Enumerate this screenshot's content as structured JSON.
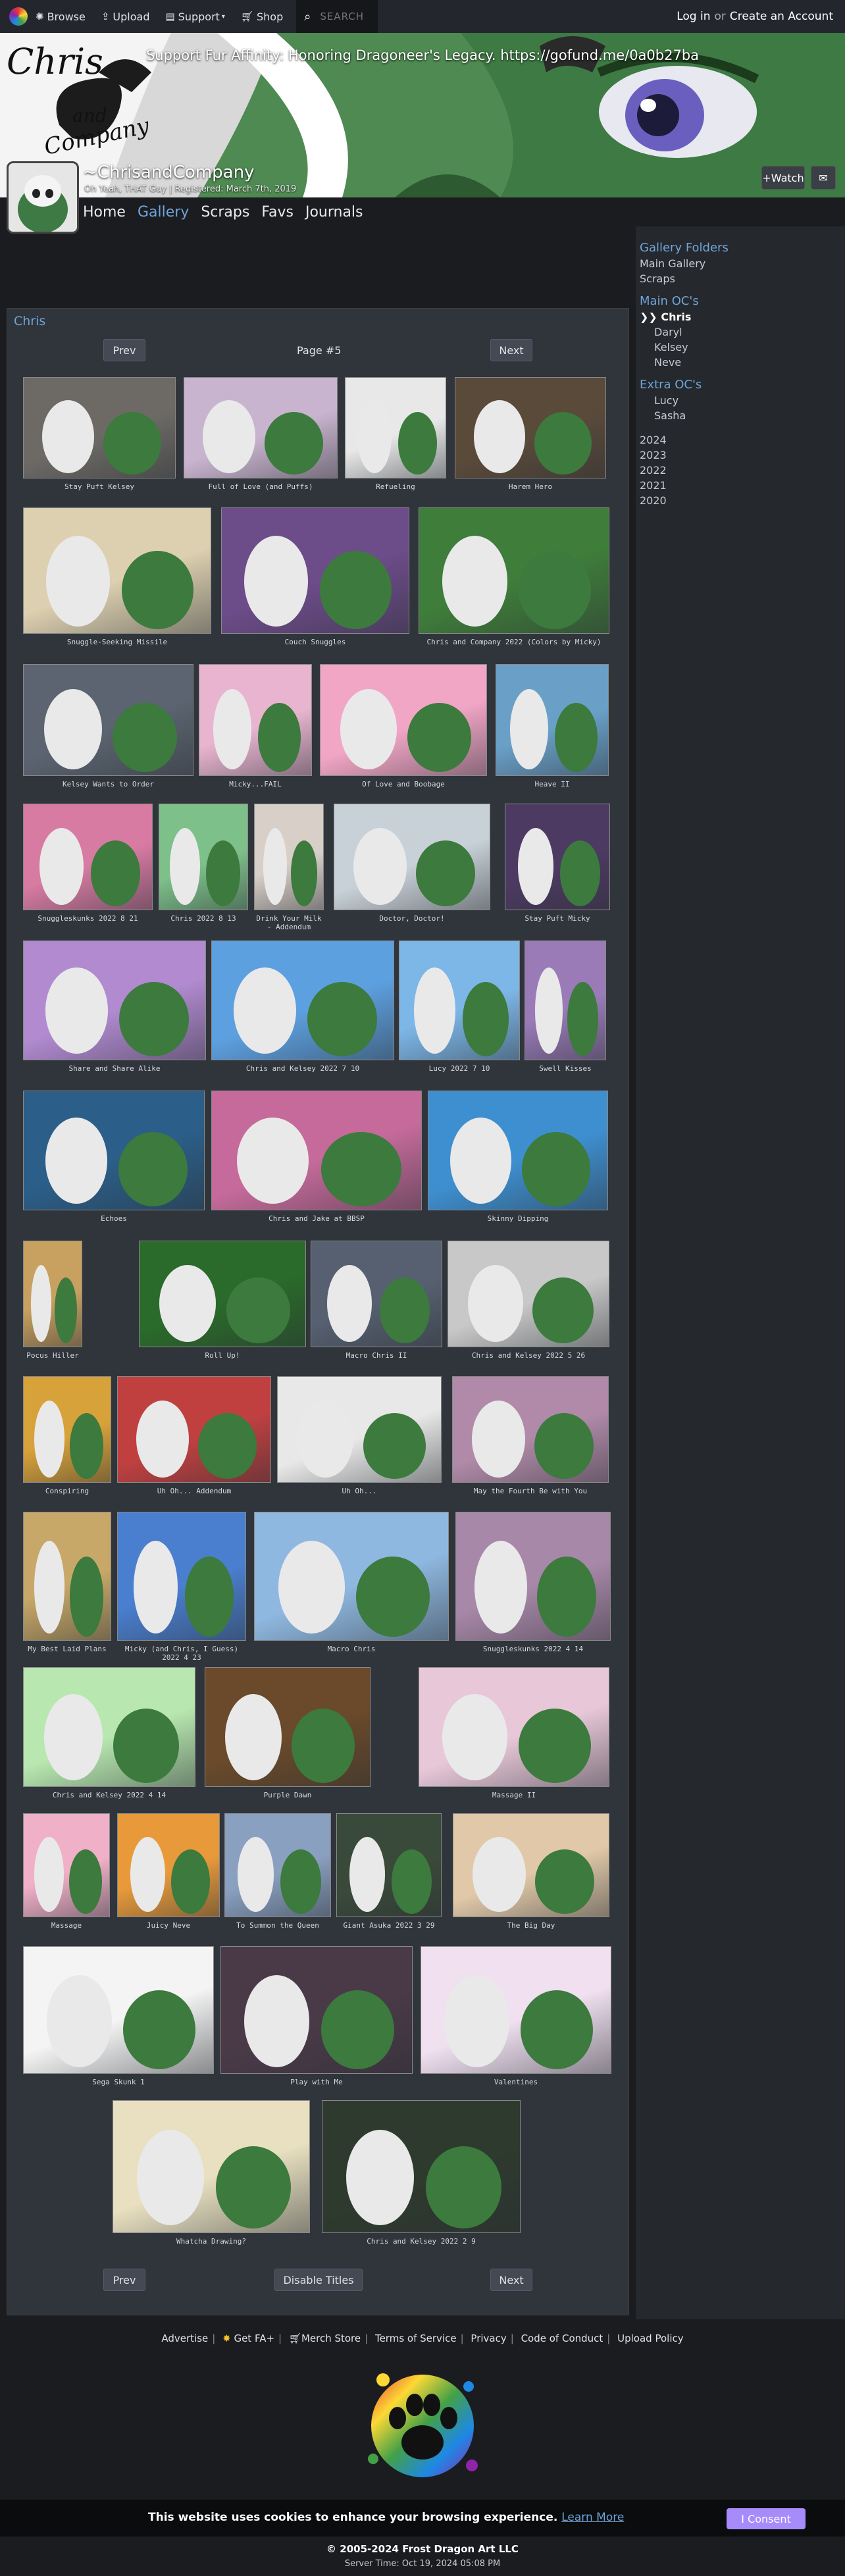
{
  "topnav": {
    "browse": "Browse",
    "upload": "Upload",
    "support": "Support",
    "shop": "Shop",
    "search_placeholder": "SEARCH",
    "login": "Log in",
    "or": "or",
    "create_account": "Create an Account"
  },
  "banner": {
    "notice": "Support Fur Affinity: Honoring Dragoneer's Legacy. https://gofund.me/0a0b27ba",
    "art_text_1": "Chris",
    "art_text_2": "and",
    "art_text_3": "Company"
  },
  "profile": {
    "username": "~ChrisandCompany",
    "tagline": "Oh Yeah, THAT Guy | Registered: March 7th, 2019",
    "watch_label": "+Watch",
    "tabs": [
      "Home",
      "Gallery",
      "Scraps",
      "Favs",
      "Journals"
    ]
  },
  "sidebar": {
    "folders_heading": "Gallery Folders",
    "main_gallery": "Main Gallery",
    "scraps": "Scraps",
    "main_oc_heading": "Main OC's",
    "main_ocs": [
      "Chris",
      "Daryl",
      "Kelsey",
      "Neve"
    ],
    "active_marker": "❯❯",
    "extra_oc_heading": "Extra OC's",
    "extra_ocs": [
      "Lucy",
      "Sasha"
    ],
    "years": [
      "2024",
      "2023",
      "2022",
      "2021",
      "2020"
    ]
  },
  "gallery": {
    "title": "Chris",
    "prev": "Prev",
    "next": "Next",
    "page": "Page #5",
    "disable_titles": "Disable Titles",
    "items": [
      {
        "title": "Stay Puft Kelsey",
        "color": "#6d6a66"
      },
      {
        "title": "Full of Love (and Puffs)",
        "color": "#c9b4cf"
      },
      {
        "title": "Refueling",
        "color": "#e8e8e8"
      },
      {
        "title": "Harem Hero",
        "color": "#5a4a3a"
      },
      {
        "title": "Snuggle-Seeking Missile",
        "color": "#ddd0b0"
      },
      {
        "title": "Couch Snuggles",
        "color": "#6d4c8a"
      },
      {
        "title": "Chris and Company 2022 (Colors by Micky)",
        "color": "#3f7d3a"
      },
      {
        "title": "Kelsey Wants to Order",
        "color": "#5b6470"
      },
      {
        "title": "Micky...FAIL",
        "color": "#e8b4d0"
      },
      {
        "title": "Of Love and Boobage",
        "color": "#f2a6c6"
      },
      {
        "title": "Heave II",
        "color": "#6aa0c8"
      },
      {
        "title": "Snuggleskunks 2022 8 21",
        "color": "#d87ba3"
      },
      {
        "title": "Chris 2022 8 13",
        "color": "#7ec08a"
      },
      {
        "title": "Drink Your Milk - Addendum",
        "color": "#d8cfc8"
      },
      {
        "title": "Doctor, Doctor!",
        "color": "#c9d1d8"
      },
      {
        "title": "Stay Puft Micky",
        "color": "#4d3a62"
      },
      {
        "title": "Share and Share Alike",
        "color": "#b18ad0"
      },
      {
        "title": "Chris and Kelsey 2022 7 10",
        "color": "#5da0e0"
      },
      {
        "title": "Lucy 2022 7 10",
        "color": "#7db7e8"
      },
      {
        "title": "Swell Kisses",
        "color": "#9a7bb8"
      },
      {
        "title": "Echoes",
        "color": "#2b5e88"
      },
      {
        "title": "Chris and Jake at BBSP",
        "color": "#c56a9a"
      },
      {
        "title": "Skinny Dipping",
        "color": "#3e8fd0"
      },
      {
        "title": "Pocus Hiller",
        "color": "#c8a060"
      },
      {
        "title": "Roll Up!",
        "color": "#2a6a2a"
      },
      {
        "title": "Macro Chris II",
        "color": "#566070"
      },
      {
        "title": "Chris and Kelsey 2022 5 26",
        "color": "#c8c8c8"
      },
      {
        "title": "Conspiring",
        "color": "#d8a23a"
      },
      {
        "title": "Uh Oh... Addendum",
        "color": "#c04040"
      },
      {
        "title": "Uh Oh...",
        "color": "#e8e8e8"
      },
      {
        "title": "May the Fourth Be with You",
        "color": "#b08aa8"
      },
      {
        "title": "My Best Laid Plans",
        "color": "#c8a868"
      },
      {
        "title": "Micky (and Chris, I Guess) 2022 4 23",
        "color": "#4a7fd0"
      },
      {
        "title": "Macro Chris",
        "color": "#8fb8e0"
      },
      {
        "title": "Snuggleskunks 2022 4 14",
        "color": "#a888a8"
      },
      {
        "title": "Chris and Kelsey 2022 4 14",
        "color": "#b8e8b0"
      },
      {
        "title": "Purple Dawn",
        "color": "#6a4a2a"
      },
      {
        "title": "Massage II",
        "color": "#e8c8d8"
      },
      {
        "title": "Massage",
        "color": "#f0b0c8"
      },
      {
        "title": "Juicy Neve",
        "color": "#e89a3a"
      },
      {
        "title": "To Summon the Queen",
        "color": "#8aa0c0"
      },
      {
        "title": "Giant Asuka 2022 3 29",
        "color": "#3a4a3a"
      },
      {
        "title": "The Big Day",
        "color": "#e0c8a8"
      },
      {
        "title": "Sega Skunk 1",
        "color": "#f4f4f4"
      },
      {
        "title": "Play with Me",
        "color": "#4a3a48"
      },
      {
        "title": "Valentines",
        "color": "#f0e0f0"
      },
      {
        "title": "Whatcha Drawing?",
        "color": "#e8e0c0"
      },
      {
        "title": "Chris and Kelsey 2022 2 9",
        "color": "#2e3a2e"
      }
    ]
  },
  "footer": {
    "links": [
      "Advertise",
      "Get FA+",
      "Merch Store",
      "Terms of Service",
      "Privacy",
      "Code of Conduct",
      "Upload Policy"
    ],
    "cookie_text": "This website uses cookies to enhance your browsing experience.",
    "learn_more": "Learn More",
    "consent": "I Consent",
    "copyright": "© 2005-2024 Frost Dragon Art LLC",
    "server_time": "Server Time: Oct 19, 2024 05:08 PM"
  }
}
